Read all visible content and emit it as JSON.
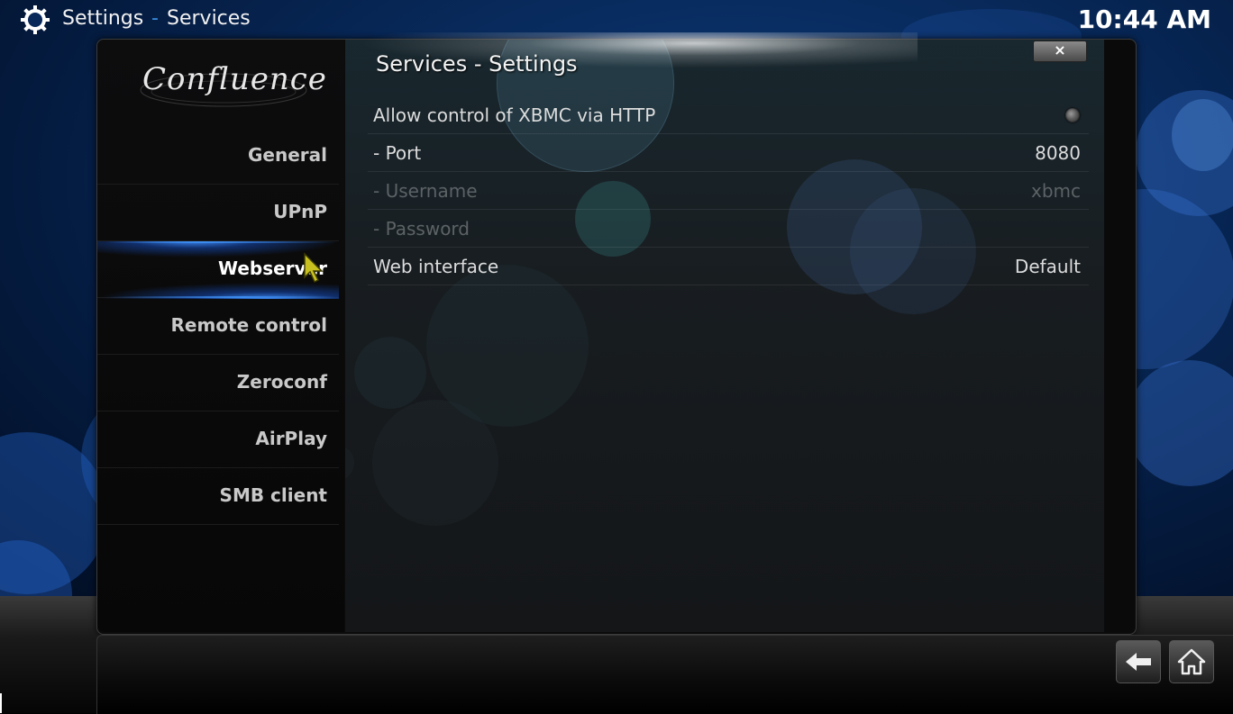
{
  "header": {
    "section": "Settings",
    "separator": "-",
    "subsection": "Services",
    "clock": "10:44 AM"
  },
  "dialog": {
    "title": "Services - Settings",
    "close_label": "×",
    "logo_text": "Confluence"
  },
  "sidebar": {
    "items": [
      {
        "label": "General"
      },
      {
        "label": "UPnP"
      },
      {
        "label": "Webserver"
      },
      {
        "label": "Remote control"
      },
      {
        "label": "Zeroconf"
      },
      {
        "label": "AirPlay"
      },
      {
        "label": "SMB client"
      }
    ],
    "active_index": 2
  },
  "settings": [
    {
      "label": "Allow control of XBMC via HTTP",
      "value": "",
      "type": "radio",
      "enabled": true
    },
    {
      "label": "- Port",
      "value": "8080",
      "type": "text",
      "enabled": true
    },
    {
      "label": "- Username",
      "value": "xbmc",
      "type": "text",
      "enabled": false
    },
    {
      "label": "- Password",
      "value": "",
      "type": "text",
      "enabled": false
    },
    {
      "label": "Web interface",
      "value": "Default",
      "type": "select",
      "enabled": true
    }
  ],
  "colors": {
    "accent": "#3c8cf0",
    "background": "#082a5c"
  },
  "icons": [
    "gear-icon",
    "close-icon",
    "back-arrow-icon",
    "home-icon",
    "radio-icon",
    "pointer-icon"
  ]
}
